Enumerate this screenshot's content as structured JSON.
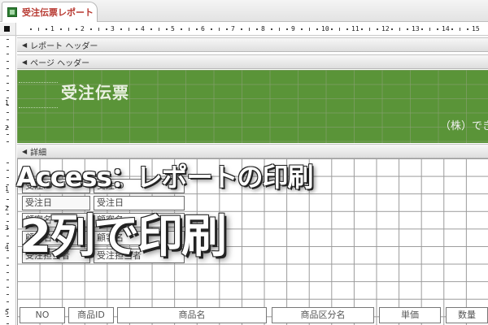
{
  "tab": {
    "label": "受注伝票レポート",
    "icon": "report-icon",
    "label_color": "#b7372f"
  },
  "ruler": {
    "h_numbers": [
      "1",
      "2",
      "3",
      "4",
      "5",
      "6",
      "7",
      "8",
      "9",
      "10",
      "11",
      "12",
      "13",
      "14",
      "15"
    ],
    "v_numbers": [
      "1",
      "2",
      "1",
      "2",
      "3",
      "4",
      "5"
    ]
  },
  "sections": {
    "report_header": "レポート ヘッダー",
    "page_header": "ページ ヘッダー",
    "detail": "詳細"
  },
  "page_header": {
    "title": "受注伝票",
    "company": "（株）でき",
    "background_color": "#5a9438"
  },
  "detail_controls": {
    "row1": [
      "受注ID",
      "受注ID"
    ],
    "row2": [
      "受注日",
      "受注日"
    ],
    "row3": [
      "顧客名",
      "顧客名"
    ],
    "row4": [
      "顧客名",
      "顧客名"
    ],
    "row5": [
      "受注担当者",
      "受注担当者"
    ]
  },
  "column_headers": [
    "NO",
    "商品ID",
    "商品名",
    "商品区分名",
    "単価",
    "数量"
  ],
  "overlay": {
    "line1": "Access：レポートの印刷",
    "line2": "2列で印刷"
  }
}
